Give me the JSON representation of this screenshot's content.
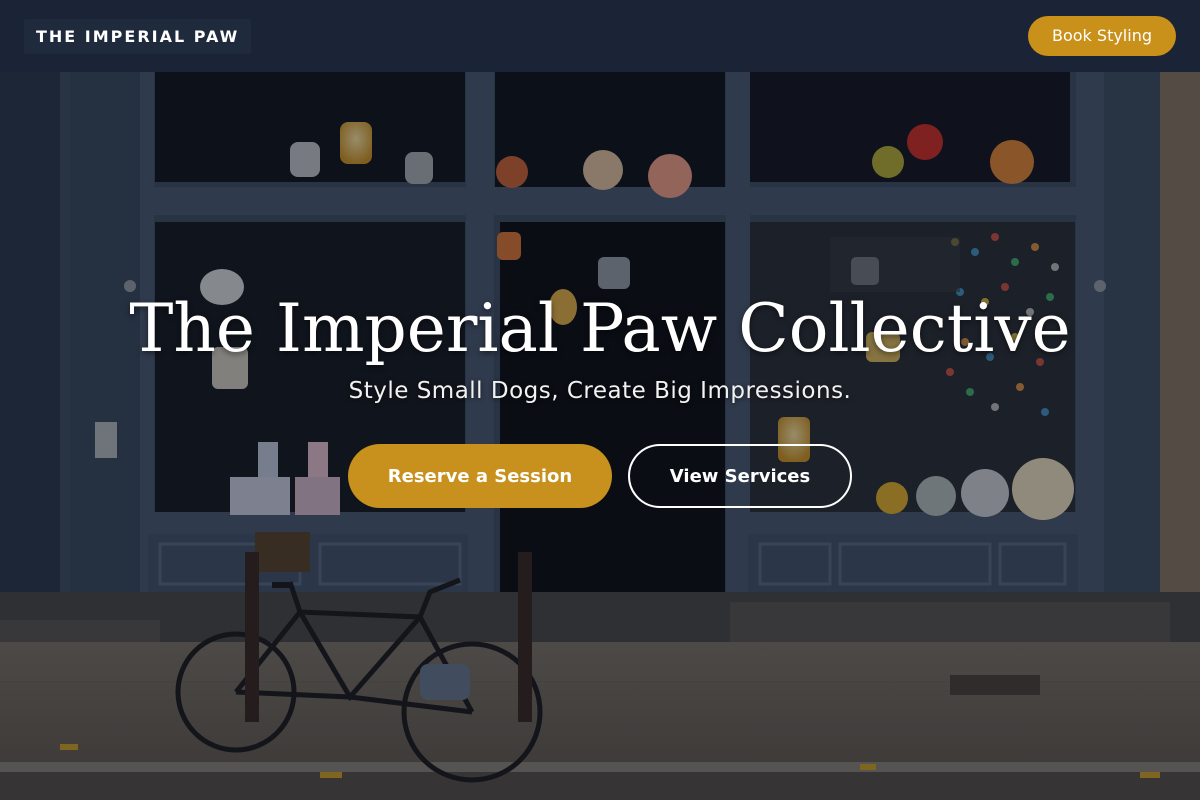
{
  "nav": {
    "brand": "THE IMPERIAL PAW",
    "cta_label": "Book Styling"
  },
  "hero": {
    "title": "The Imperial Paw Collective",
    "subtitle": "Style Small Dogs, Create Big Impressions.",
    "primary_button": "Reserve a Session",
    "secondary_button": "View Services",
    "background_description_icon": "storefront-photo"
  },
  "colors": {
    "nav_bg": "#1b2436",
    "accent": "#c9901a",
    "text": "#ffffff"
  }
}
